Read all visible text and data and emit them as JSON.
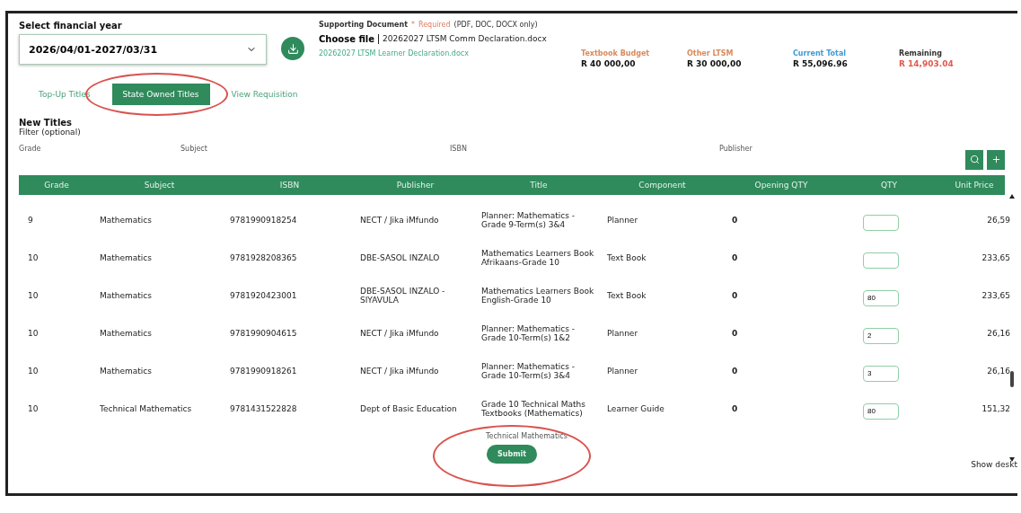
{
  "year_select": {
    "label": "Select financial year",
    "value": "2026/04/01-2027/03/31"
  },
  "upload": {
    "label": "Supporting Document",
    "required_mark": "*",
    "required_text": "Required",
    "formats": "(PDF, DOC, DOCX only)",
    "button": "Choose file",
    "file_name": "20262027 LTSM Comm Declaration.docx",
    "link": "20262027 LTSM Learner Declaration.docx"
  },
  "summary": [
    {
      "label": "Textbook Budget",
      "value": "R 40 000,00",
      "color": "#d98a5a",
      "kind": "normal"
    },
    {
      "label": "Other LTSM",
      "value": "R 30 000,00",
      "color": "#d98a5a",
      "kind": "normal"
    },
    {
      "label": "Current Total",
      "value": "R 55,096.96",
      "color": "#3d9ad6",
      "kind": "normal"
    },
    {
      "label": "Remaining",
      "value": "R 14,903.04",
      "color": "#333333",
      "kind": "alert"
    }
  ],
  "tabs": [
    {
      "label": "Top-Up Titles",
      "selected": false,
      "circled": false
    },
    {
      "label": "State Owned Titles",
      "selected": true,
      "circled": true
    },
    {
      "label": "View Requisition",
      "selected": false,
      "circled": false
    }
  ],
  "section_title": "New Titles",
  "filter_title": "Filter (optional)",
  "filters": [
    "Grade",
    "Subject",
    "ISBN",
    "Publisher"
  ],
  "table": {
    "columns": [
      "Grade",
      "Subject",
      "ISBN",
      "Publisher",
      "Title",
      "Component",
      "Opening QTY",
      "QTY",
      "Unit Price"
    ],
    "rows": [
      {
        "grade": "9",
        "subject": "Mathematics",
        "isbn": "9781990918254",
        "publisher": "NECT / Jika iMfundo",
        "title": "Planner: Mathematics - Grade 9-Term(s) 3&4",
        "component": "Planner",
        "opening_qty": "0",
        "qty": "",
        "unit_price": "26,59"
      },
      {
        "grade": "10",
        "subject": "Mathematics",
        "isbn": "9781928208365",
        "publisher": "DBE-SASOL INZALO",
        "title": "Mathematics Learners Book Afrikaans-Grade 10",
        "component": "Text Book",
        "opening_qty": "0",
        "qty": "",
        "unit_price": "233,65"
      },
      {
        "grade": "10",
        "subject": "Mathematics",
        "isbn": "9781920423001",
        "publisher": "DBE-SASOL INZALO - SIYAVULA",
        "title": "Mathematics Learners Book English-Grade 10",
        "component": "Text Book",
        "opening_qty": "0",
        "qty": "80",
        "unit_price": "233,65"
      },
      {
        "grade": "10",
        "subject": "Mathematics",
        "isbn": "9781990904615",
        "publisher": "NECT / Jika iMfundo",
        "title": "Planner: Mathematics - Grade 10-Term(s) 1&2",
        "component": "Planner",
        "opening_qty": "0",
        "qty": "2",
        "unit_price": "26,16"
      },
      {
        "grade": "10",
        "subject": "Mathematics",
        "isbn": "9781990918261",
        "publisher": "NECT / Jika iMfundo",
        "title": "Planner: Mathematics - Grade 10-Term(s) 3&4",
        "component": "Planner",
        "opening_qty": "0",
        "qty": "3",
        "unit_price": "26,16"
      },
      {
        "grade": "10",
        "subject": "Technical Mathematics",
        "isbn": "9781431522828",
        "publisher": "Dept of Basic Education",
        "title": "Grade 10 Technical Maths Textbooks (Mathematics)",
        "component": "Learner Guide",
        "opening_qty": "0",
        "qty": "80",
        "unit_price": "151,32"
      }
    ],
    "next_row_title": "Technical Mathematics"
  },
  "submit": {
    "label": "Submit",
    "circled": true
  },
  "footer_link": "Show deskt"
}
